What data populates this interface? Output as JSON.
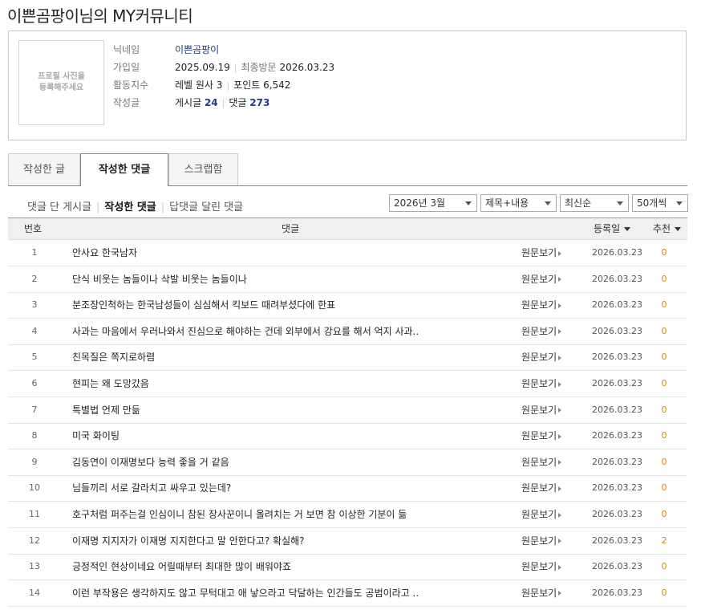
{
  "page_title": "이쁜곰팡이님의 MY커뮤니티",
  "profile": {
    "photo_placeholder": "프로필 사진을\n등록해주세요",
    "nickname_label": "닉네임",
    "nickname": "이쁜곰팡이",
    "join_label": "가입일",
    "join_date": "2025.09.19",
    "last_visit_label": "최종방문",
    "last_visit": "2026.03.23",
    "activity_label": "활동지수",
    "level": "레벨 원사 3",
    "points": "포인트 6,542",
    "posts_label": "작성글",
    "posts_prefix": "게시글",
    "posts_count": "24",
    "comments_prefix": "댓글",
    "comments_count": "273"
  },
  "tabs": [
    "작성한 글",
    "작성한 댓글",
    "스크랩함"
  ],
  "active_tab": 1,
  "subnav": [
    "댓글 단 게시글",
    "작성한 댓글",
    "답댓글 달린 댓글"
  ],
  "filters": {
    "month": "2026년 3월",
    "search_type": "제목+내용",
    "sort": "최신순",
    "per_page": "50개씩"
  },
  "table": {
    "headers": {
      "num": "번호",
      "comment": "댓글",
      "date": "등록일",
      "rec": "추천"
    },
    "link_label": "원문보기",
    "rows": [
      {
        "num": "1",
        "text": "안사요 한국남자",
        "date": "2026.03.23",
        "rec": "0"
      },
      {
        "num": "2",
        "text": "단식 비웃는 놈들이나 삭발 비웃는 놈들이나",
        "date": "2026.03.23",
        "rec": "0"
      },
      {
        "num": "3",
        "text": "분조장인척하는 한국남성들이 심심해서 킥보드 때려부셨다에 한표",
        "date": "2026.03.23",
        "rec": "0"
      },
      {
        "num": "4",
        "text": "사과는 마음에서 우러나와서 진심으로 해야하는 건데 외부에서 강요를 해서 억지 사과..",
        "date": "2026.03.23",
        "rec": "0"
      },
      {
        "num": "5",
        "text": "친목질은 쪽지로하렴",
        "date": "2026.03.23",
        "rec": "0"
      },
      {
        "num": "6",
        "text": "현피는 왜 도망갔음",
        "date": "2026.03.23",
        "rec": "0"
      },
      {
        "num": "7",
        "text": "특별법 언제 만듦",
        "date": "2026.03.23",
        "rec": "0"
      },
      {
        "num": "8",
        "text": "미국 화이팅",
        "date": "2026.03.23",
        "rec": "0"
      },
      {
        "num": "9",
        "text": "김동연이 이재명보다 능력 좋을 거 같음",
        "date": "2026.03.23",
        "rec": "0"
      },
      {
        "num": "10",
        "text": "님들끼리 서로 갈라치고 싸우고 있는데?",
        "date": "2026.03.23",
        "rec": "0"
      },
      {
        "num": "11",
        "text": "호구처럼 퍼주는걸 인심이니 참된 장사꾼이니 올려치는 거 보면 참 이상한 기분이 듦",
        "date": "2026.03.23",
        "rec": "0"
      },
      {
        "num": "12",
        "text": "이재명 지지자가 이재명 지지한다고 말 안한다고? 확실해?",
        "date": "2026.03.23",
        "rec": "2"
      },
      {
        "num": "13",
        "text": "긍정적인 현상이네요 어릴때부터 최대한 많이 배워야죠",
        "date": "2026.03.23",
        "rec": "0"
      },
      {
        "num": "14",
        "text": "이런 부작용은 생각하지도 않고 무턱대고 애 낳으라고 닥달하는 인간들도 공범이라고 ..",
        "date": "2026.03.23",
        "rec": "0"
      }
    ]
  }
}
